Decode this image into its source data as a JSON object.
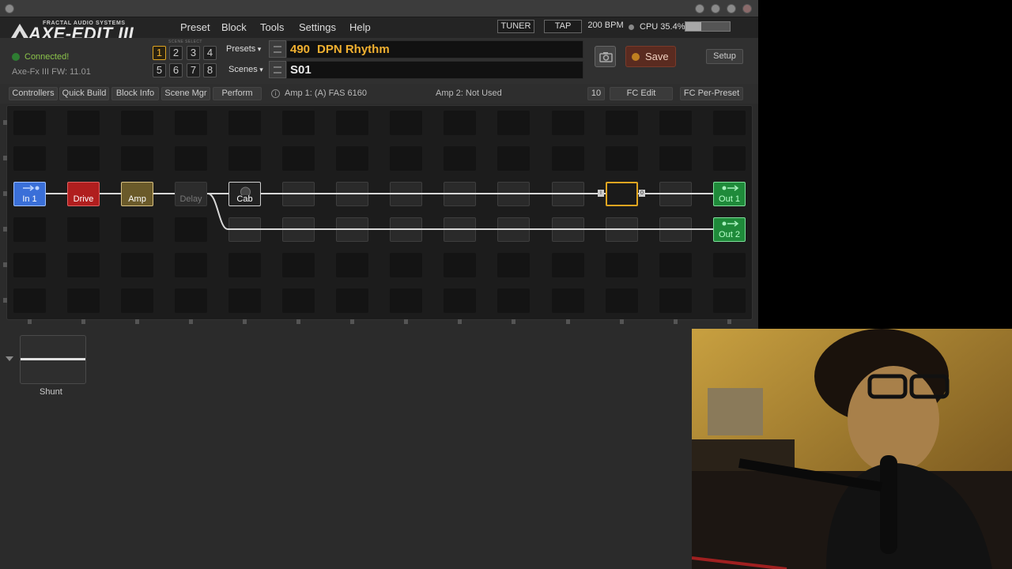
{
  "app": {
    "brand_top": "FRACTAL AUDIO SYSTEMS",
    "brand_main": "AXE-EDIT III"
  },
  "menu": [
    "Preset",
    "Block",
    "Tools",
    "Settings",
    "Help"
  ],
  "header": {
    "tuner": "TUNER",
    "tap": "TAP",
    "bpm": "200 BPM",
    "cpu": "CPU 35.4%",
    "cpu_level": 0.354
  },
  "status": {
    "connected": "Connected!",
    "firmware": "Axe-Fx III FW: 11.01"
  },
  "scene_select": {
    "label": "SCENE SELECT",
    "buttons": [
      "1",
      "2",
      "3",
      "4",
      "5",
      "6",
      "7",
      "8"
    ],
    "active": "1"
  },
  "preset": {
    "presets_label": "Presets",
    "scenes_label": "Scenes",
    "number": "490",
    "name": "DPN Rhythm",
    "scene": "S01"
  },
  "actions": {
    "save": "Save",
    "setup": "Setup"
  },
  "toolbar": {
    "buttons": [
      "Controllers",
      "Quick Build",
      "Block Info",
      "Scene Mgr",
      "Perform"
    ],
    "info_glyph": "i",
    "amp1": "Amp 1: (A) FAS 6160",
    "amp2": "Amp 2: Not Used",
    "fc_num": "10",
    "fc_edit": "FC Edit",
    "fc_per_preset": "FC Per-Preset"
  },
  "grid": {
    "blocks": [
      {
        "name": "In 1",
        "color": "#3a6fd8"
      },
      {
        "name": "Drive",
        "color": "#b01e1e"
      },
      {
        "name": "Amp",
        "color": "#6a5a2a"
      },
      {
        "name": "Delay",
        "color": "#2c2c2c"
      },
      {
        "name": "Cab",
        "color": "#222222"
      },
      {
        "name": "Out 1",
        "color": "#1f8a3a"
      },
      {
        "name": "Out 2",
        "color": "#1f8a3a"
      }
    ],
    "mixer_labels": [
      "I",
      "0"
    ]
  },
  "shunt": {
    "label": "Shunt"
  }
}
